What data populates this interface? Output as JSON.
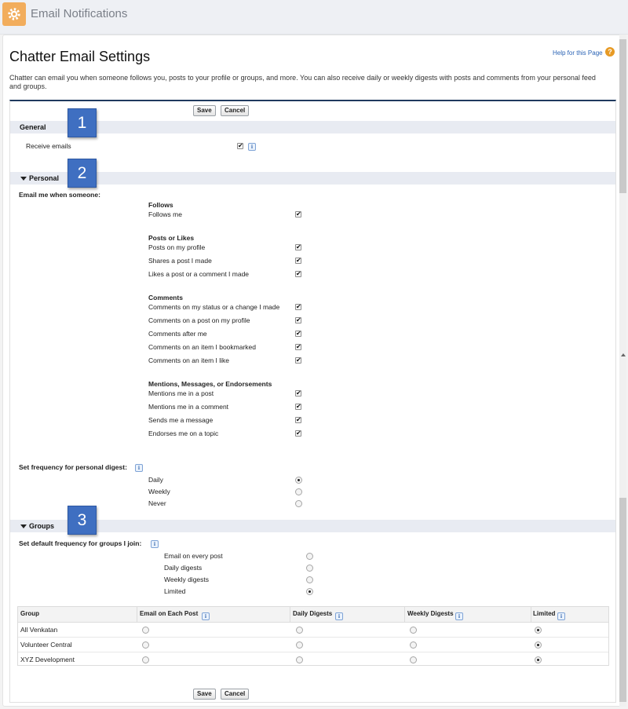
{
  "header": {
    "title": "Email Notifications"
  },
  "page": {
    "title": "Chatter Email Settings",
    "help_link": "Help for this Page",
    "help_icon": "?",
    "intro": "Chatter can email you when someone follows you, posts to your profile or groups, and more. You can also receive daily or weekly digests with posts and comments from your personal feed and groups."
  },
  "buttons": {
    "save": "Save",
    "cancel": "Cancel"
  },
  "info_glyph": "i",
  "check_glyph": "✔",
  "callouts": [
    "1",
    "2",
    "3"
  ],
  "general": {
    "title": "General",
    "receive_emails": "Receive emails",
    "receive_checked": true
  },
  "personal": {
    "title": "Personal",
    "email_me": "Email me when someone:",
    "groups": [
      {
        "title": "Follows",
        "items": [
          {
            "label": "Follows me",
            "checked": true
          }
        ]
      },
      {
        "title": "Posts or Likes",
        "items": [
          {
            "label": "Posts on my profile",
            "checked": true
          },
          {
            "label": "Shares a post I made",
            "checked": true
          },
          {
            "label": "Likes a post or a comment I made",
            "checked": true
          }
        ]
      },
      {
        "title": "Comments",
        "items": [
          {
            "label": "Comments on my status or a change I made",
            "checked": true
          },
          {
            "label": "Comments on a post on my profile",
            "checked": true
          },
          {
            "label": "Comments after me",
            "checked": true
          },
          {
            "label": "Comments on an item I bookmarked",
            "checked": true
          },
          {
            "label": "Comments on an item I like",
            "checked": true
          }
        ]
      },
      {
        "title": "Mentions, Messages, or Endorsements",
        "items": [
          {
            "label": "Mentions me in a post",
            "checked": true
          },
          {
            "label": "Mentions me in a comment",
            "checked": true
          },
          {
            "label": "Sends me a message",
            "checked": true
          },
          {
            "label": "Endorses me on a topic",
            "checked": true
          }
        ]
      }
    ],
    "digest_label": "Set frequency for personal digest:",
    "digest_options": [
      {
        "label": "Daily",
        "selected": true
      },
      {
        "label": "Weekly",
        "selected": false
      },
      {
        "label": "Never",
        "selected": false
      }
    ]
  },
  "groups": {
    "title": "Groups",
    "default_label": "Set default frequency for groups I join:",
    "default_options": [
      {
        "label": "Email on every post",
        "selected": false
      },
      {
        "label": "Daily digests",
        "selected": false
      },
      {
        "label": "Weekly digests",
        "selected": false
      },
      {
        "label": "Limited",
        "selected": true
      }
    ],
    "table": {
      "columns": [
        "Group",
        "Email on Each Post",
        "Daily Digests",
        "Weekly Digests",
        "Limited"
      ],
      "rows": [
        {
          "name": "All Venkatan",
          "selected": 4
        },
        {
          "name": "Volunteer Central",
          "selected": 4
        },
        {
          "name": "XYZ Development",
          "selected": 4
        }
      ]
    }
  },
  "colors": {
    "accent": "#3f6fc1",
    "gear_bg": "#f2ad5c",
    "link": "#2a63b5",
    "section_bar": "#e8ebf2"
  },
  "icons": {
    "app": "gear-icon",
    "help": "help-question-icon",
    "expand": "triangle-down-icon",
    "info": "info-icon"
  }
}
